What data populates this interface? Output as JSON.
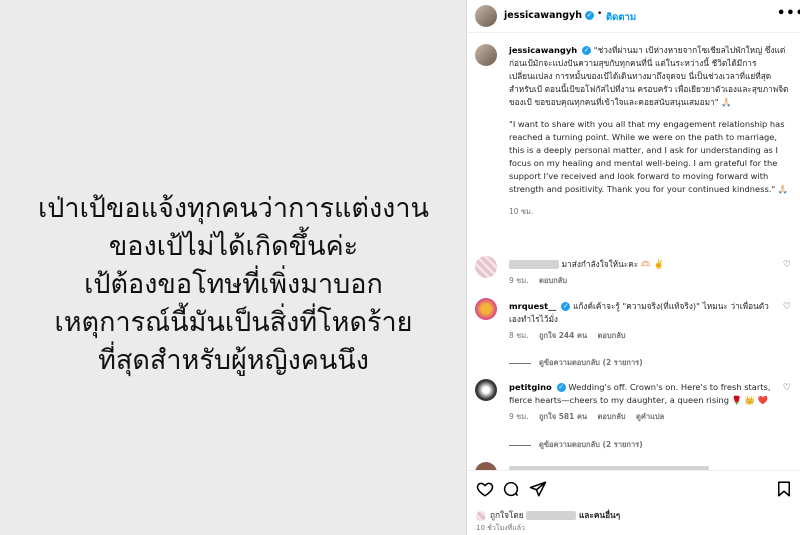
{
  "post_image": {
    "text": "เป่าเป้ขอแจ้งทุกคนว่าการแต่งงาน\nของเป้ไม่ได้เกิดขึ้นค่ะ\nเป้ต้องขอโทษที่เพิ่งมาบอก\nเหตุการณ์นี้มันเป็นสิ่งที่โหดร้าย\nที่สุดสำหรับผู้หญิงคนนึง"
  },
  "header": {
    "username": "jessicawangyh",
    "dot": "•",
    "follow_label": "ติดตาม",
    "more_label": "•••"
  },
  "caption": {
    "username": "jessicawangyh",
    "thai_text": "\"ช่วงที่ผ่านมา เป้ห่างหายจากโซเชียลไปพักใหญ่ ซึ่งแต่ก่อนเป้มักจะแบ่งปันความสุขกับทุกคนที่นี่ แต่ในระหว่างนี้ ชีวิตได้มีการเปลี่ยนแปลง การหมั้นของเป้ได้เดินทางมาถึงจุดจบ นี่เป็นช่วงเวลาที่แย่ที่สุดสำหรับเป้ ตอนนี้เป้ขอโฟกัสไปที่งาน ครอบครัว เพื่อเยียวยาตัวเองและสุขภาพจิตของเป้ ขอขอบคุณทุกคนที่เข้าใจและคอยสนับสนุนเสมอมา\" 🙏🏻",
    "english_text": "\"I want to share with you all that my engagement relationship has reached a turning point. While we were on the path to marriage, this is a deeply personal matter, and I ask for understanding as I focus on my healing and mental well-being. I am grateful for the support I've received and look forward to moving forward with strength and positivity. Thank you for your continued kindness.\" 🙏🏻",
    "time": "10 ชม."
  },
  "comments": [
    {
      "username": "",
      "text": "มาส่งกำลังใจให้นะคะ 🫶🏻 ✌️",
      "time": "9 ชม.",
      "reply_label": "ตอบกลับ"
    },
    {
      "username": "mrquest__",
      "text": "แก้งค์เค้าจะรู้ \"ความจริง(ที่แท้จริง)\" ไหมนะ ว่าเพื่อนตัวเองทำไรไว้มั่ง",
      "time": "8 ชม.",
      "likes": "ถูกใจ 244 คน",
      "reply_label": "ตอบกลับ",
      "view_replies": "ดูข้อความตอบกลับ (2 รายการ)"
    },
    {
      "username": "petitgino",
      "text": "Wedding's off. Crown's on. Here's to fresh starts, fierce hearts—cheers to my daughter, a queen rising 🌹 👑 ❤️",
      "time": "9 ชม.",
      "likes": "ถูกใจ 581 คน",
      "reply_label": "ตอบกลับ",
      "translate_label": "ดูคำแปล",
      "view_replies": "ดูข้อความตอบกลับ (2 รายการ)"
    }
  ],
  "footer": {
    "liked_by_prefix": "ถูกใจโดย",
    "liked_by_suffix": "และคนอื่นๆ",
    "time": "10 ชั่วโมงที่แล้ว"
  }
}
